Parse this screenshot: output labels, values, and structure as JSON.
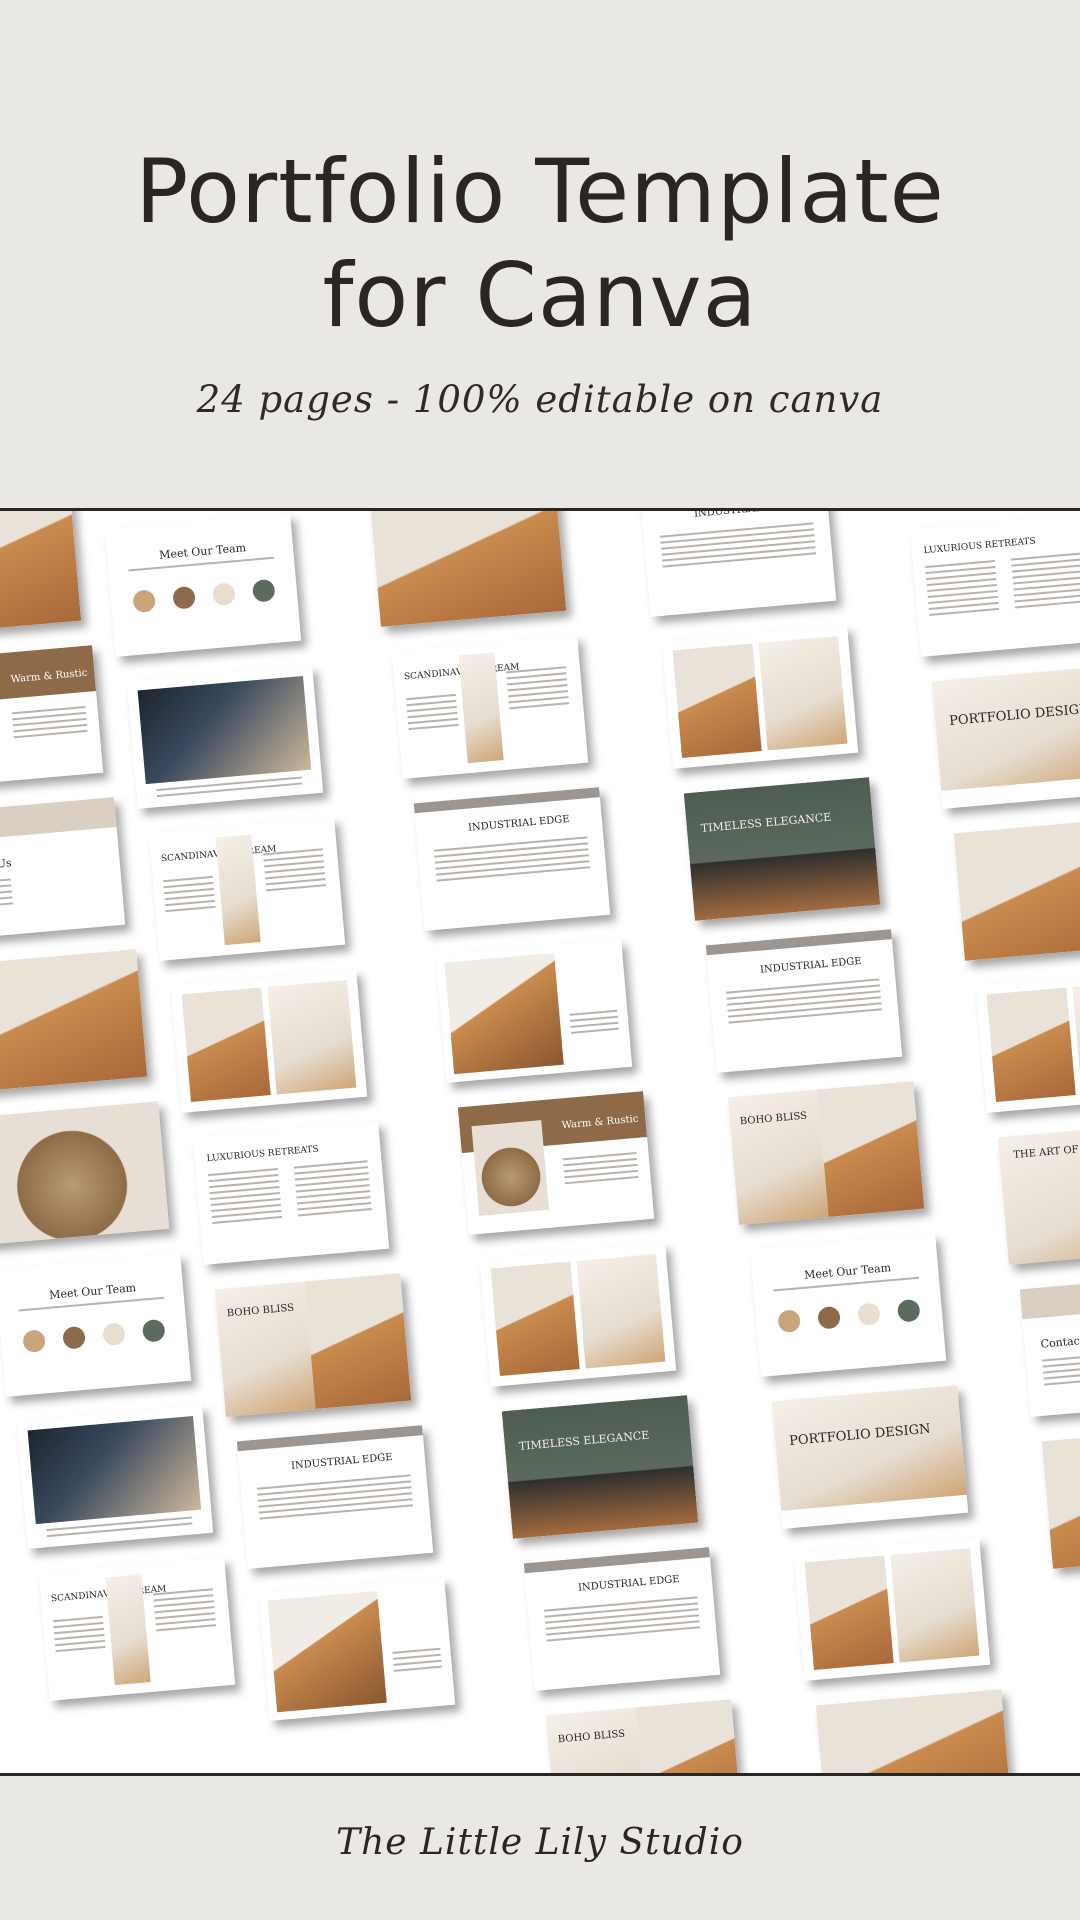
{
  "header": {
    "title_line1": "Portfolio Template",
    "title_line2": "for Canva",
    "subtitle": "24 pages - 100% editable on canva"
  },
  "footer": {
    "brand": "The Little Lily Studio"
  },
  "page_labels": {
    "meet_team": "Meet Our Team",
    "scandinavian": "SCANDINAVIAN DREAM",
    "timeless": "TIMELESS ELEGANCE",
    "industrial": "INDUSTRIAL EDGE",
    "boho": "BOHO BLISS",
    "warm": "Warm & Rustic",
    "luxurious": "LUXURIOUS RETREATS",
    "portfolio": "PORTFOLIO DESIGN",
    "contact": "Contact Us",
    "art_of": "THE ART OF B"
  },
  "colors": {
    "background": "#eae8e5",
    "ink": "#2b2624",
    "accent_brown": "#8f6a48",
    "beige": "#d9cfc3"
  }
}
